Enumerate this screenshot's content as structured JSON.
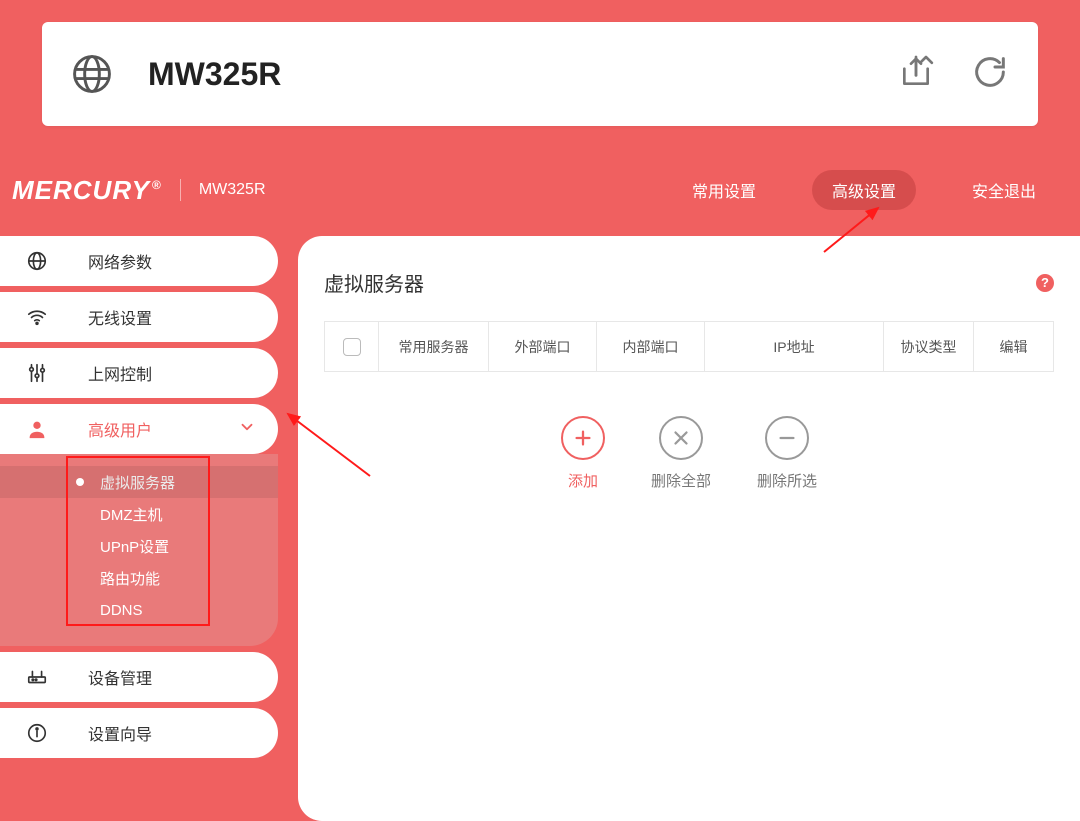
{
  "browser": {
    "title": "MW325R"
  },
  "brand": {
    "name": "MERCURY",
    "model": "MW325R"
  },
  "nav": {
    "common": "常用设置",
    "advanced": "高级设置",
    "logout": "安全退出"
  },
  "sidebar": {
    "network": "网络参数",
    "wireless": "无线设置",
    "control": "上网控制",
    "advanced_user": "高级用户",
    "device_mgmt": "设备管理",
    "wizard": "设置向导"
  },
  "submenu": {
    "vs": "虚拟服务器",
    "dmz": "DMZ主机",
    "upnp": "UPnP设置",
    "route": "路由功能",
    "ddns": "DDNS"
  },
  "panel": {
    "title": "虚拟服务器",
    "col_common": "常用服务器",
    "col_ext_port": "外部端口",
    "col_int_port": "内部端口",
    "col_ip": "IP地址",
    "col_proto": "协议类型",
    "col_edit": "编辑"
  },
  "actions": {
    "add": "添加",
    "delete_all": "删除全部",
    "delete_selected": "删除所选"
  }
}
